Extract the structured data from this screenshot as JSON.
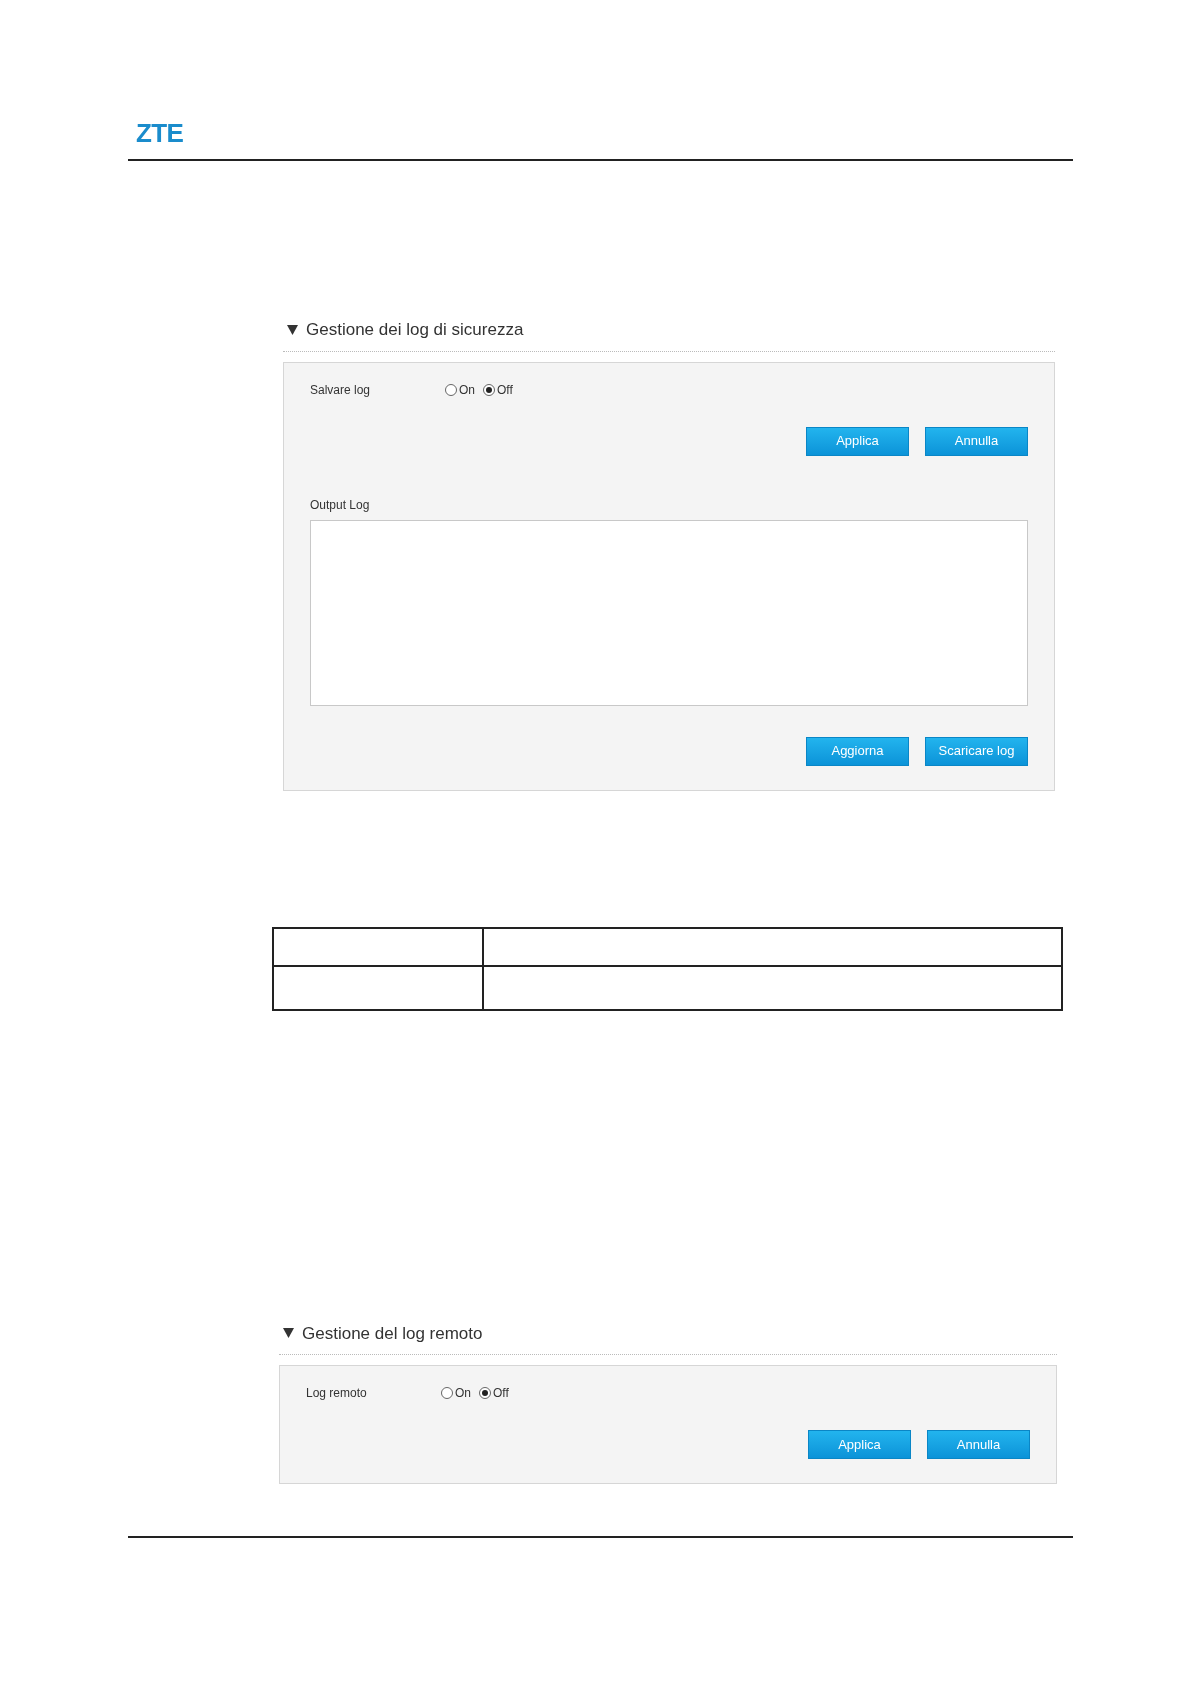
{
  "logo": "ZTE",
  "sections": [
    {
      "title": "Gestione dei log di sicurezza",
      "expanded": true,
      "setting": {
        "label": "Salvare log",
        "options": [
          {
            "label": "On",
            "selected": false
          },
          {
            "label": "Off",
            "selected": true
          }
        ]
      },
      "buttons": [
        "Applica",
        "Annulla"
      ],
      "output": {
        "label": "Output Log"
      },
      "output_buttons": [
        "Aggiorna",
        "Scaricare log"
      ]
    },
    {
      "title": "Gestione del log remoto",
      "expanded": true,
      "setting": {
        "label": "Log remoto",
        "options": [
          {
            "label": "On",
            "selected": false
          },
          {
            "label": "Off",
            "selected": true
          }
        ]
      },
      "buttons": [
        "Applica",
        "Annulla"
      ]
    }
  ]
}
